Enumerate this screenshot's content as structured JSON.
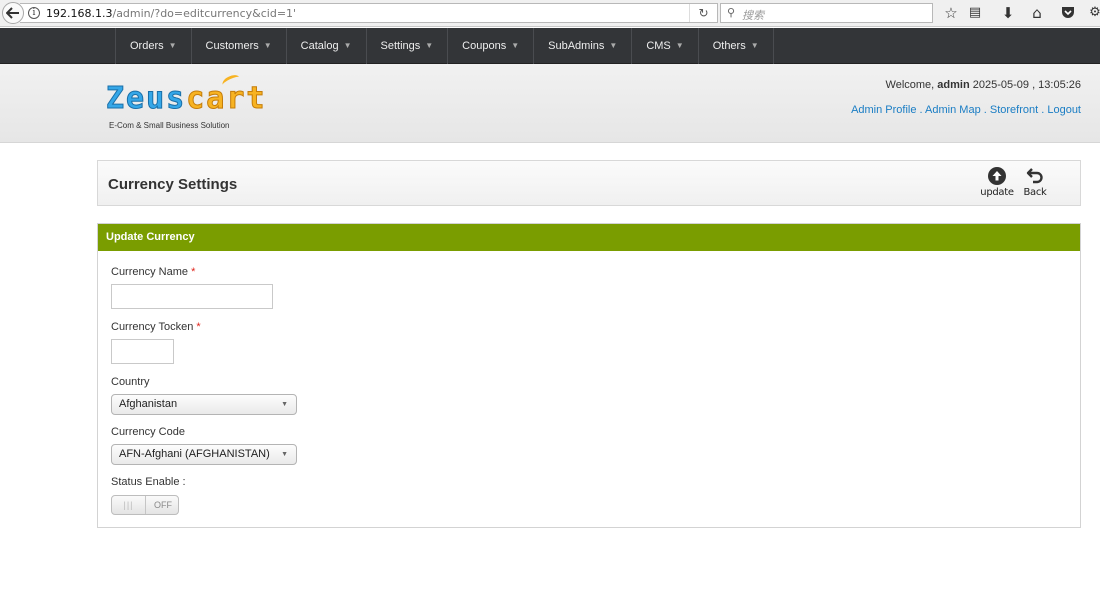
{
  "browser": {
    "url_host": "192.168.1.3",
    "url_path": "/admin/?do=editcurrency&cid=1'",
    "search_placeholder": "搜索",
    "icons": [
      "back-icon",
      "info-icon",
      "reload-icon",
      "search-icon",
      "star-icon",
      "reader-icon",
      "download-icon",
      "home-icon",
      "pocket-icon",
      "extension-icon"
    ]
  },
  "nav": {
    "items": [
      {
        "label": "Orders"
      },
      {
        "label": "Customers"
      },
      {
        "label": "Catalog"
      },
      {
        "label": "Settings"
      },
      {
        "label": "Coupons"
      },
      {
        "label": "SubAdmins"
      },
      {
        "label": "CMS"
      },
      {
        "label": "Others"
      }
    ]
  },
  "header": {
    "logo_text_1": "Zeus",
    "logo_text_2": "cart",
    "tagline": "E-Com & Small Business Solution",
    "welcome_prefix": "Welcome, ",
    "username": "admin",
    "datetime": " 2025-05-09 , 13:05:26",
    "links": [
      "Admin Profile",
      "Admin Map",
      "Storefront",
      "Logout"
    ]
  },
  "page": {
    "title": "Currency Settings",
    "update_label": "update",
    "back_label": "Back"
  },
  "form": {
    "heading": "Update Currency",
    "currency_name_label": "Currency Name",
    "currency_name_value": "",
    "currency_token_label": "Currency Tocken",
    "currency_token_value": "",
    "required_mark": "*",
    "country_label": "Country",
    "country_value": "Afghanistan",
    "currency_code_label": "Currency Code",
    "currency_code_value": "AFN-Afghani (AFGHANISTAN)",
    "status_label": "Status Enable :",
    "status_value": "OFF",
    "status_handle": "|||"
  },
  "colors": {
    "nav_bg": "#333538",
    "panel_head": "#7a9d00",
    "link": "#1a7dc4",
    "required": "#e0241b"
  }
}
